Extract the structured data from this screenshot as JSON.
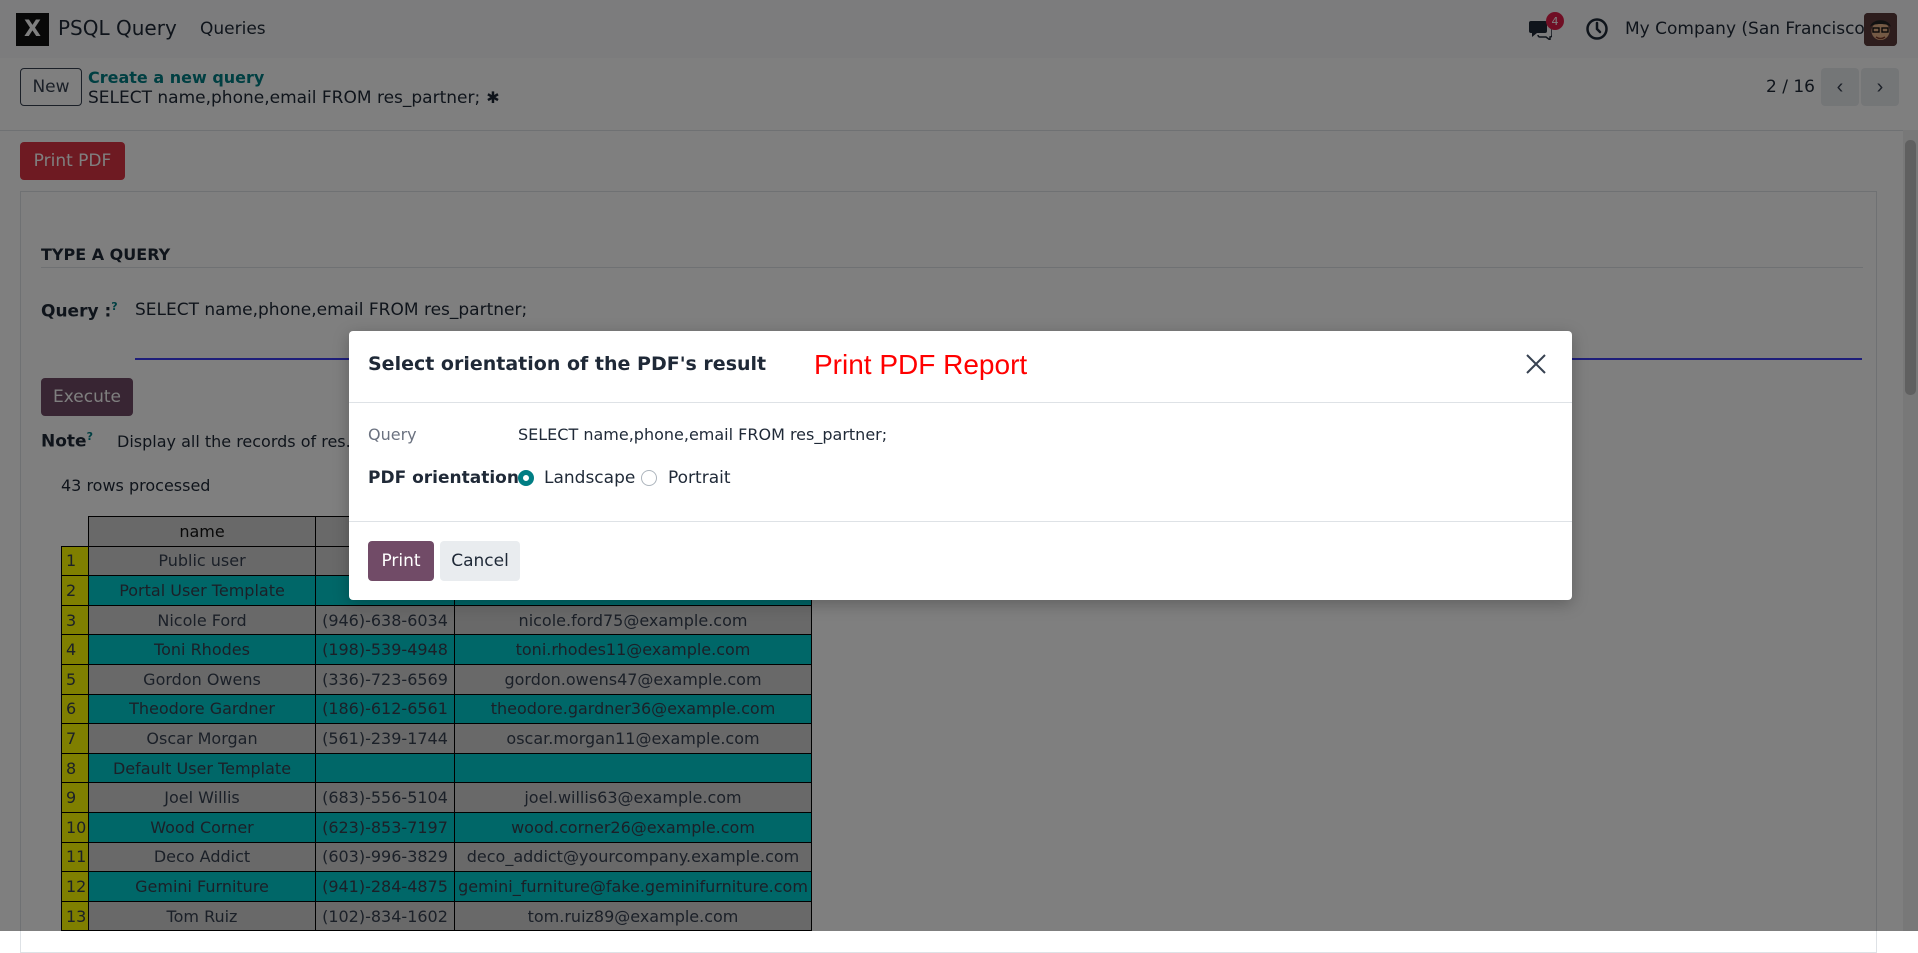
{
  "navbar": {
    "logo_text": "X",
    "app_title": "PSQL Query",
    "menu_item": "Queries",
    "chat_badge": "4",
    "company": "My Company (San Francisco)"
  },
  "control": {
    "new_label": "New",
    "breadcrumb_parent": "Create a new query",
    "breadcrumb_current": "SELECT name,phone,email FROM res_partner;",
    "pager_value": "2 / 16"
  },
  "form": {
    "print_pdf_label": "Print PDF",
    "section_title": "TYPE A QUERY",
    "query_label": "Query :",
    "help_mark": "?",
    "query_value": "SELECT name,phone,email FROM res_partner;",
    "execute_label": "Execute",
    "note_label": "Note",
    "note_value": "Display all the records of res.p",
    "rows_processed": "43 rows processed"
  },
  "table": {
    "header_name": "name",
    "rows": [
      {
        "n": "1",
        "name": "Public user",
        "phone": "",
        "email": ""
      },
      {
        "n": "2",
        "name": "Portal User Template",
        "phone": "",
        "email": ""
      },
      {
        "n": "3",
        "name": "Nicole Ford",
        "phone": "(946)-638-6034",
        "email": "nicole.ford75@example.com"
      },
      {
        "n": "4",
        "name": "Toni Rhodes",
        "phone": "(198)-539-4948",
        "email": "toni.rhodes11@example.com"
      },
      {
        "n": "5",
        "name": "Gordon Owens",
        "phone": "(336)-723-6569",
        "email": "gordon.owens47@example.com"
      },
      {
        "n": "6",
        "name": "Theodore Gardner",
        "phone": "(186)-612-6561",
        "email": "theodore.gardner36@example.com"
      },
      {
        "n": "7",
        "name": "Oscar Morgan",
        "phone": "(561)-239-1744",
        "email": "oscar.morgan11@example.com"
      },
      {
        "n": "8",
        "name": "Default User Template",
        "phone": "",
        "email": ""
      },
      {
        "n": "9",
        "name": "Joel Willis",
        "phone": "(683)-556-5104",
        "email": "joel.willis63@example.com"
      },
      {
        "n": "10",
        "name": "Wood Corner",
        "phone": "(623)-853-7197",
        "email": "wood.corner26@example.com"
      },
      {
        "n": "11",
        "name": "Deco Addict",
        "phone": "(603)-996-3829",
        "email": "deco_addict@yourcompany.example.com"
      },
      {
        "n": "12",
        "name": "Gemini Furniture",
        "phone": "(941)-284-4875",
        "email": "gemini_furniture@fake.geminifurniture.com"
      },
      {
        "n": "13",
        "name": "Tom Ruiz",
        "phone": "(102)-834-1602",
        "email": "tom.ruiz89@example.com"
      }
    ]
  },
  "dialog": {
    "title": "Select orientation of the PDF's result",
    "banner": "Print PDF Report",
    "query_label": "Query",
    "query_value": "SELECT name,phone,email FROM res_partner;",
    "orientation_label": "PDF orientation",
    "opt_landscape": "Landscape",
    "opt_portrait": "Portrait",
    "print_label": "Print",
    "cancel_label": "Cancel"
  },
  "colors": {
    "accent": "#714b67",
    "teal": "#017e84",
    "danger": "#dc3545",
    "row_even": "#00ced1",
    "row_num": "#ffff00"
  }
}
